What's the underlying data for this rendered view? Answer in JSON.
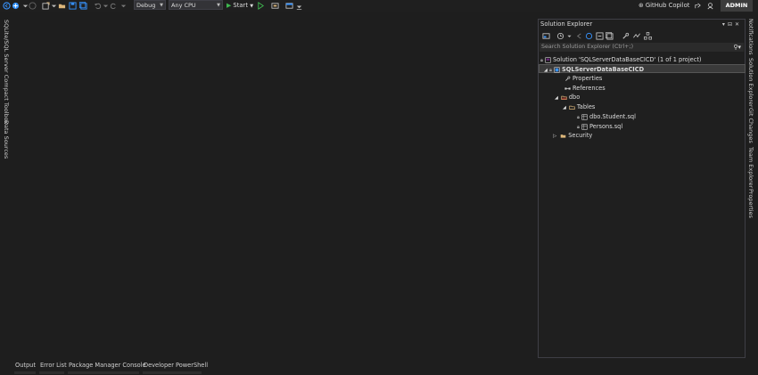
{
  "toolbar": {
    "config_value": "Debug",
    "platform_value": "Any CPU",
    "start_label": "Start",
    "copilot_label": "GitHub Copilot",
    "admin_label": "ADMIN"
  },
  "left_tabs": [
    "SQLite/SQL Server Compact Toolbox",
    "Data Sources"
  ],
  "right_tabs": [
    "Notifications",
    "Solution Explorer",
    "Git Changes",
    "Team Explorer",
    "Properties"
  ],
  "solution_explorer": {
    "title": "Solution Explorer",
    "search_placeholder": "Search Solution Explorer (Ctrl+;)",
    "tree": {
      "solution": "Solution 'SQLServerDataBaseCICD' (1 of 1 project)",
      "project": "SQLServerDataBaseCICD",
      "properties": "Properties",
      "references": "References",
      "dbo": "dbo",
      "tables": "Tables",
      "file1": "dbo.Student.sql",
      "file2": "Persons.sql",
      "security": "Security"
    }
  },
  "bottom_tabs": [
    "Output",
    "Error List",
    "Package Manager Console",
    "Developer PowerShell"
  ],
  "colors": {
    "background": "#1e1e1e",
    "accent_blue": "#3794ff",
    "play_green": "#3fb950",
    "folder_yellow": "#dcb67a"
  }
}
